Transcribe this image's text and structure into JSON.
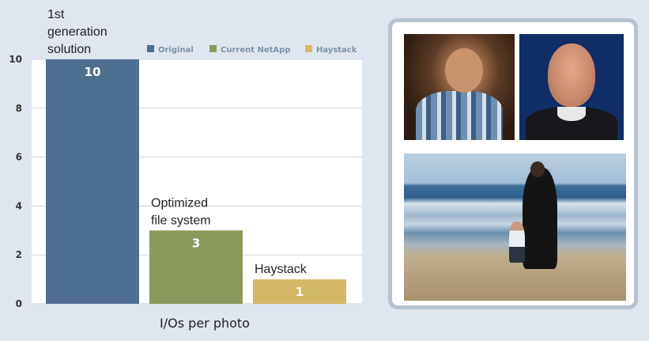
{
  "chart_data": {
    "type": "bar",
    "categories": [
      "Original",
      "Current NetApp",
      "Haystack"
    ],
    "values": [
      10,
      3,
      1
    ],
    "colors": [
      "#4f6f91",
      "#8a9a5b",
      "#d5b866"
    ],
    "annotations": [
      [
        "1st",
        "generation",
        "solution"
      ],
      [
        "Optimized",
        "file system"
      ],
      [
        "Haystack"
      ]
    ],
    "legend": [
      "Original",
      "Current NetApp",
      "Haystack"
    ],
    "legend_position": "top-right",
    "yticks": [
      "0",
      "2",
      "4",
      "6",
      "8",
      "10"
    ],
    "ylim": [
      0,
      10
    ],
    "xlabel": "I/Os per photo",
    "ylabel": "",
    "grid": true
  },
  "photos": [
    {
      "name": "photo-man-shirt",
      "description_icon": "person-photo"
    },
    {
      "name": "photo-bald-man",
      "description_icon": "person-photo"
    },
    {
      "name": "photo-beach",
      "description_icon": "beach-photo"
    }
  ]
}
